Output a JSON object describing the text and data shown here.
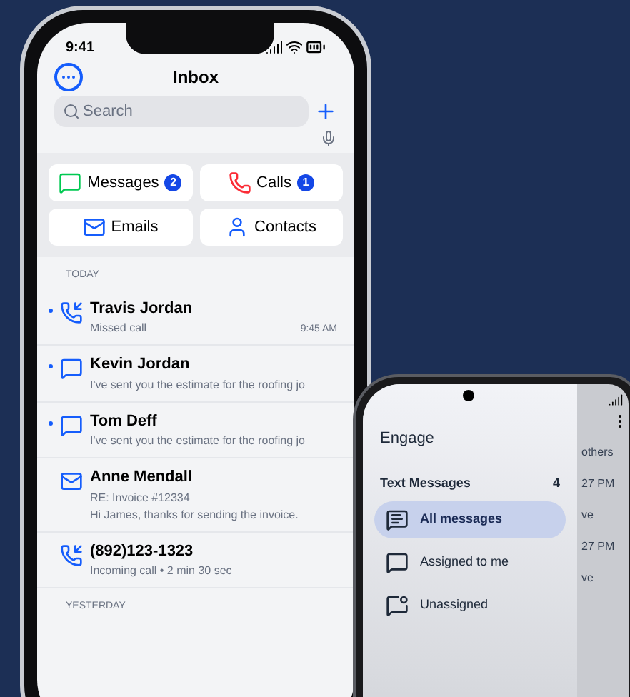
{
  "iphone": {
    "status_time": "9:41",
    "title": "Inbox",
    "search": {
      "placeholder": "Search"
    },
    "filters": [
      {
        "kind": "messages",
        "label": "Messages",
        "badge": "2"
      },
      {
        "kind": "calls",
        "label": "Calls",
        "badge": "1"
      },
      {
        "kind": "emails",
        "label": "Emails"
      },
      {
        "kind": "contacts",
        "label": "Contacts"
      }
    ],
    "section_heading": "TODAY",
    "items": [
      {
        "kind": "call",
        "name": "Travis Jordan",
        "lines": [
          "Missed call"
        ],
        "time": "9:45 AM",
        "unread": true
      },
      {
        "kind": "message",
        "name": "Kevin Jordan",
        "lines": [
          "I've sent you the estimate for the roofing jo"
        ],
        "unread": true
      },
      {
        "kind": "message",
        "name": "Tom Deff",
        "lines": [
          "I've sent you the estimate for the roofing jo"
        ],
        "unread": true
      },
      {
        "kind": "email",
        "name": "Anne Mendall",
        "lines": [
          "RE: Invoice #12334",
          "Hi James, thanks for sending the invoice."
        ],
        "unread": false
      },
      {
        "kind": "call",
        "name": "(892)123-1323",
        "lines": [
          "Incoming call • 2 min 30 sec"
        ],
        "unread": false
      }
    ],
    "next_heading": "YESTERDAY"
  },
  "android": {
    "drawer": {
      "title": "Engage",
      "section": {
        "label": "Text Messages",
        "count": "4"
      },
      "items": [
        {
          "kind": "all",
          "label": "All messages",
          "selected": true
        },
        {
          "kind": "assigned",
          "label": "Assigned to me",
          "selected": false
        },
        {
          "kind": "unassigned",
          "label": "Unassigned",
          "selected": false
        }
      ]
    },
    "background_list": [
      "others",
      "27 PM",
      "ve",
      "27 PM",
      "ve"
    ]
  }
}
